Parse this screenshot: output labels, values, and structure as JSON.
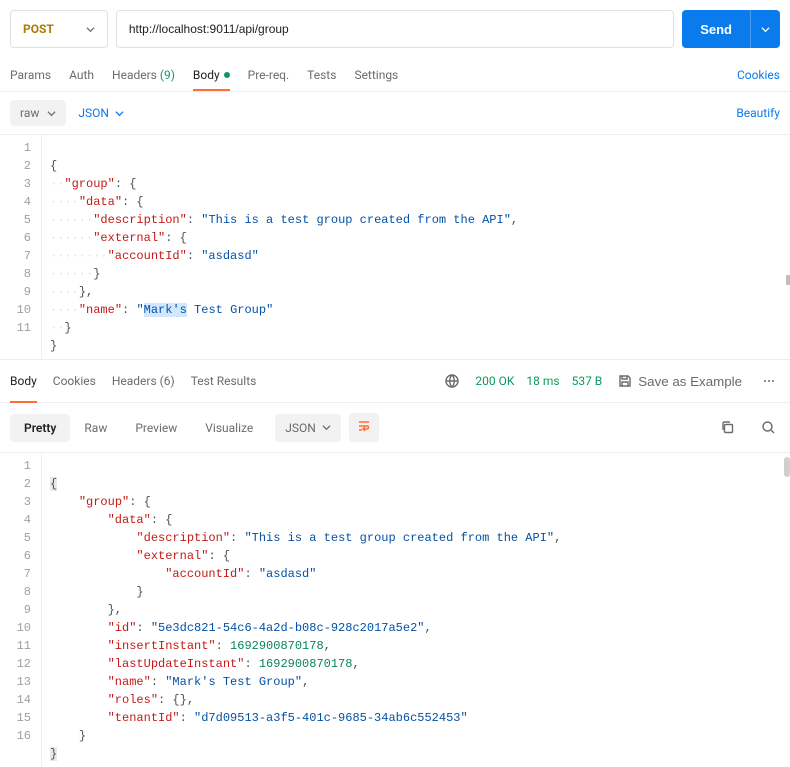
{
  "request": {
    "method": "POST",
    "url": "http://localhost:9011/api/group",
    "send_label": "Send"
  },
  "reqTabs": {
    "params": "Params",
    "auth": "Auth",
    "headers": "Headers",
    "headers_count": "(9)",
    "body": "Body",
    "prereq": "Pre-req.",
    "tests": "Tests",
    "settings": "Settings",
    "cookies": "Cookies"
  },
  "subtype": {
    "raw": "raw",
    "json": "JSON",
    "beautify": "Beautify"
  },
  "requestBody": {
    "lineCount": 11,
    "k_group": "\"group\"",
    "k_data": "\"data\"",
    "k_description": "\"description\"",
    "v_description": "\"This is a test group created from the API\"",
    "k_external": "\"external\"",
    "k_accountId": "\"accountId\"",
    "v_accountId": "\"asdasd\"",
    "k_name": "\"name\"",
    "v_name_pre": "\"",
    "v_name_hl": "Mark's",
    "v_name_post": " Test Group\""
  },
  "response": {
    "tabs": {
      "body": "Body",
      "cookies": "Cookies",
      "headers": "Headers",
      "headers_count": "(6)",
      "tests": "Test Results"
    },
    "status": "200 OK",
    "time": "18 ms",
    "size": "537 B",
    "save_example": "Save as Example",
    "views": {
      "pretty": "Pretty",
      "raw": "Raw",
      "preview": "Preview",
      "visualize": "Visualize",
      "json": "JSON"
    },
    "body": {
      "lineCount": 16,
      "k_group": "\"group\"",
      "k_data": "\"data\"",
      "k_description": "\"description\"",
      "v_description": "\"This is a test group created from the API\"",
      "k_external": "\"external\"",
      "k_accountId": "\"accountId\"",
      "v_accountId": "\"asdasd\"",
      "k_id": "\"id\"",
      "v_id": "\"5e3dc821-54c6-4a2d-b08c-928c2017a5e2\"",
      "k_insertInstant": "\"insertInstant\"",
      "v_insertInstant": "1692900870178",
      "k_lastUpdateInstant": "\"lastUpdateInstant\"",
      "v_lastUpdateInstant": "1692900870178",
      "k_name": "\"name\"",
      "v_name": "\"Mark's Test Group\"",
      "k_roles": "\"roles\"",
      "k_tenantId": "\"tenantId\"",
      "v_tenantId": "\"d7d09513-a3f5-401c-9685-34ab6c552453\""
    }
  }
}
